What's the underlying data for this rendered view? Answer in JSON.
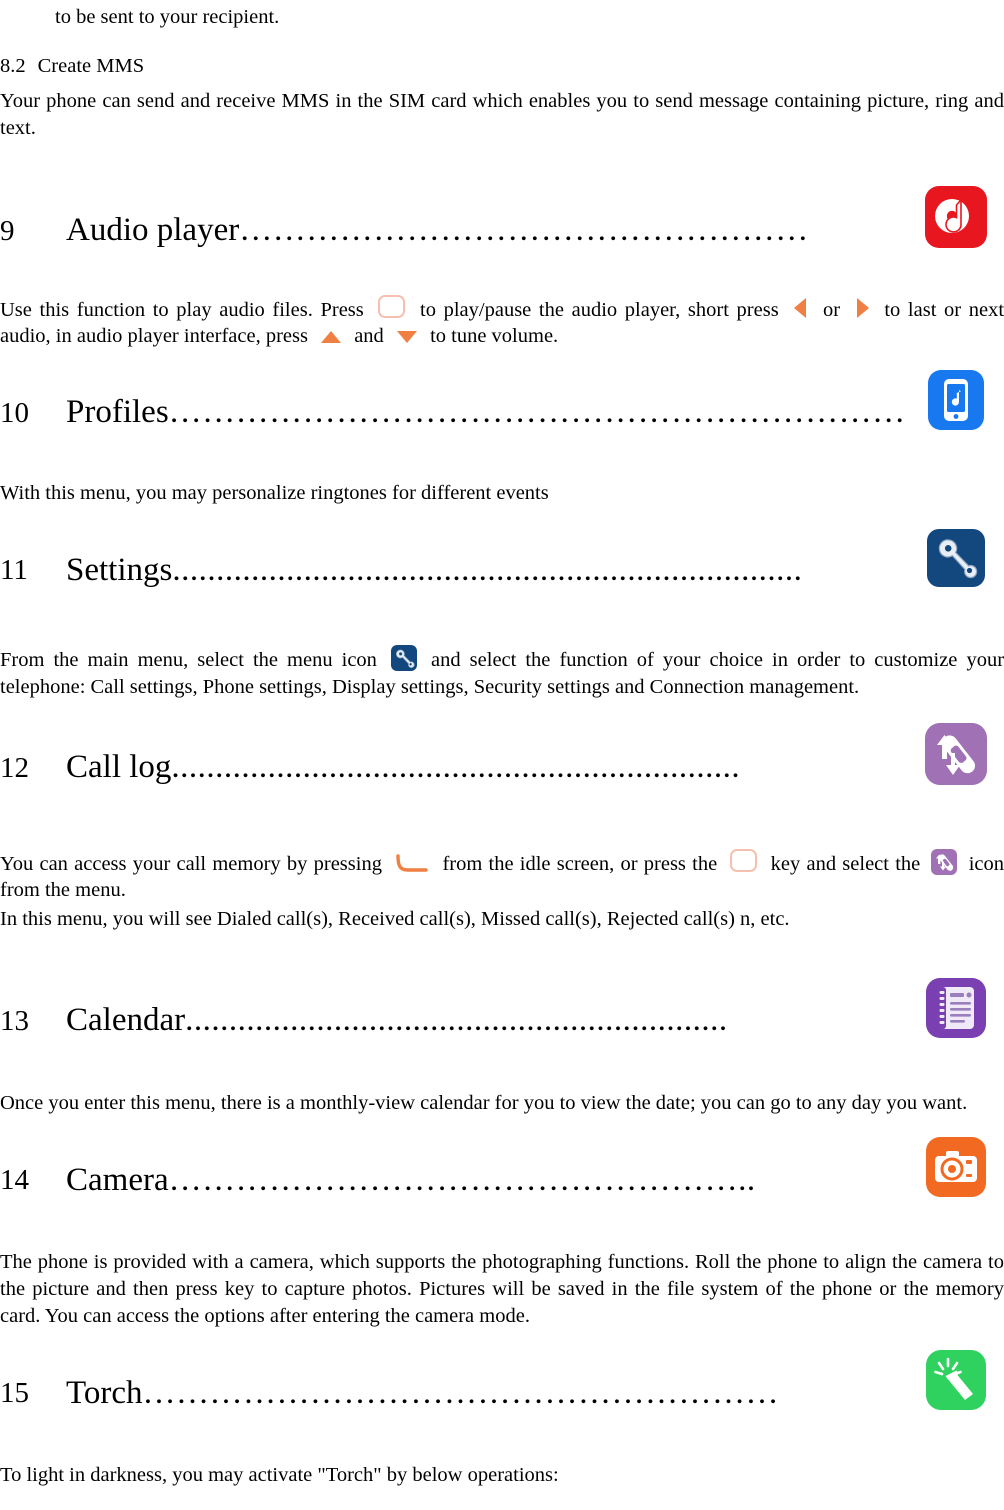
{
  "document": {
    "type": "mobile-phone-user-manual-page",
    "top_fragment": "to be sent to your recipient.",
    "section_8_2": {
      "number": "8.2",
      "title": "Create MMS",
      "body": "Your phone can send and receive MMS in the SIM card which enables you to send message containing picture, ring and text."
    },
    "chapters": [
      {
        "number": "9",
        "title": "Audio player",
        "leader": "……………………………………………",
        "icon": "audio-player-icon",
        "icon_color": "#e8161f",
        "body_parts": [
          "Use this function to play audio files. Press",
          "to play/pause the audio player, short press",
          "or",
          "to last or next audio, in audio player interface, press",
          "and",
          "to tune volume."
        ]
      },
      {
        "number": "10",
        "title": "Profiles",
        "leader": "…………………………………………………………………………...",
        "icon": "profiles-icon",
        "icon_color": "#1878f0",
        "body": "With this menu, you may personalize ringtones for different events"
      },
      {
        "number": "11",
        "title": "Settings",
        "leader": "........................................................................",
        "icon": "settings-icon",
        "icon_color": "#12487e",
        "body_parts": [
          "From the main menu, select the menu icon",
          "and select the function of your choice in order to customize your telephone: Call settings, Phone settings, Display settings, Security settings and Connection management."
        ]
      },
      {
        "number": "12",
        "title": "Call log",
        "leader": ".................................................................",
        "icon": "call-log-icon",
        "icon_color": "#a071b5",
        "body_parts": [
          "You can access your call memory by pressing",
          "from the idle screen, or press the",
          "key and select the",
          "icon from the menu."
        ],
        "body_line2": "In this menu, you will see Dialed call(s), Received call(s), Missed call(s), Rejected call(s) n, etc."
      },
      {
        "number": "13",
        "title": "Calendar",
        "leader": "..............................................................",
        "icon": "calendar-icon",
        "icon_color": "#7a3fb0",
        "body": "Once you enter this menu, there is a monthly-view calendar for you to view the date; you can go to any day you want."
      },
      {
        "number": "14",
        "title": "Camera",
        "leader": "……………………………………………..",
        "icon": "camera-icon",
        "icon_color": "#f26a21",
        "body": "The phone is provided with a camera, which supports the photographing functions. Roll the phone to align the camera to the picture and then press   key to capture photos. Pictures will be saved in the file system of the phone or the memory card. You can access the options after entering the camera mode."
      },
      {
        "number": "15",
        "title": "Torch",
        "leader": "…………………………………………………",
        "icon": "torch-icon",
        "icon_color": "#2fd25f",
        "body": "To light in darkness, you may activate \"Torch\" by below operations:"
      }
    ],
    "inline_icons": {
      "ok_key": "ok-key-icon",
      "left_arrow": "left-arrow-icon",
      "right_arrow": "right-arrow-icon",
      "up_arrow": "up-arrow-icon",
      "down_arrow": "down-arrow-icon",
      "call_key": "call-key-icon",
      "settings_small": "settings-icon",
      "call_log_small": "call-log-icon"
    },
    "colors": {
      "arrow_orange": "#ef7f42",
      "key_outline": "#f6c0b0",
      "text": "#000000",
      "background": "#ffffff"
    }
  }
}
